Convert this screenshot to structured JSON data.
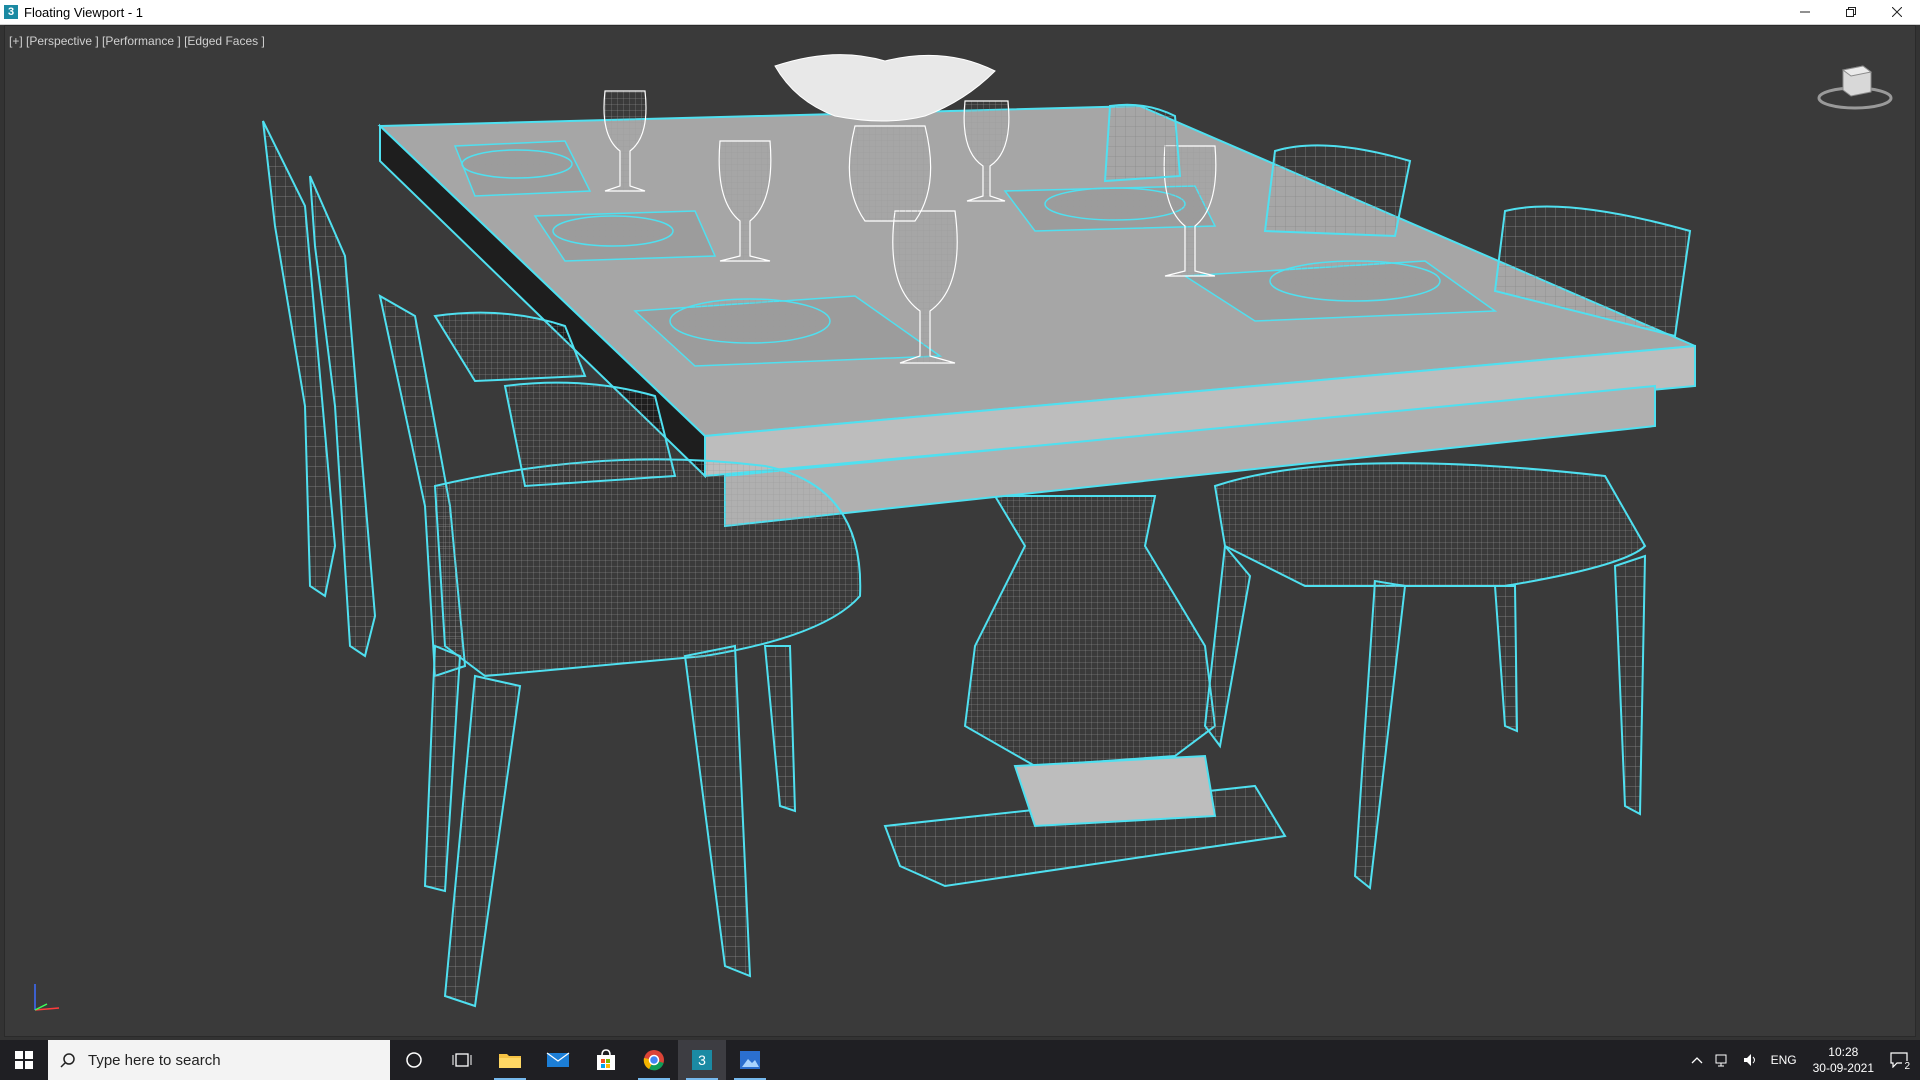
{
  "window": {
    "title": "Floating Viewport - 1",
    "app_icon_label": "3",
    "minimize_icon": "minimize-icon",
    "restore_icon": "restore-icon",
    "close_icon": "close-icon"
  },
  "viewport": {
    "label": "[+] [Perspective ] [Performance ] [Edged Faces ]",
    "background": "#3a3a3a",
    "wire_color": "#bfbfbf",
    "highlight_color": "#4fe0f0",
    "viewcube_icon": "viewcube-icon",
    "axis_icon": "axis-tripod-icon"
  },
  "taskbar": {
    "search_placeholder": "Type here to search",
    "apps": [
      {
        "name": "cortana-icon"
      },
      {
        "name": "task-view-icon"
      },
      {
        "name": "file-explorer-icon"
      },
      {
        "name": "mail-icon"
      },
      {
        "name": "store-icon"
      },
      {
        "name": "chrome-icon"
      },
      {
        "name": "3dsmax-icon"
      },
      {
        "name": "photos-icon"
      }
    ],
    "tray": {
      "language": "ENG",
      "time": "10:28",
      "date": "30-09-2021",
      "notifications_count": "2"
    }
  }
}
